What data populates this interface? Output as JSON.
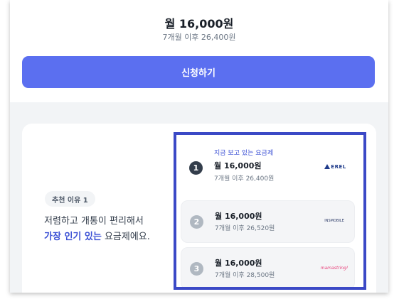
{
  "top": {
    "price": "월 16,000원",
    "price_after": "7개월 이후 26,400원",
    "apply_label": "신청하기"
  },
  "reason": {
    "badge": "추천 이유 1",
    "line1": "저렴하고 개통이 편리해서",
    "line2_highlight": "가장 인기 있는",
    "line2_rest": " 요금제에요."
  },
  "plans": [
    {
      "rank": "1",
      "tag": "지금 보고 있는 요금제",
      "price": "월 16,000원",
      "after": "7개월 이후 26,400원",
      "logo_name": "eyes-mobile-logo",
      "logo_text": "EREL"
    },
    {
      "rank": "2",
      "price": "월 16,000원",
      "after": "7개월 이후 26,520원",
      "logo_name": "carrier-logo-2",
      "logo_text": "INSMOBILE"
    },
    {
      "rank": "3",
      "price": "월 16,000원",
      "after": "7개월 이후 28,500원",
      "logo_name": "carrier-logo-3",
      "logo_text": "mamastring!"
    }
  ],
  "colors": {
    "accent": "#5b6ff0",
    "highlight": "#3d52d5",
    "selection_border": "#3b49c6"
  }
}
